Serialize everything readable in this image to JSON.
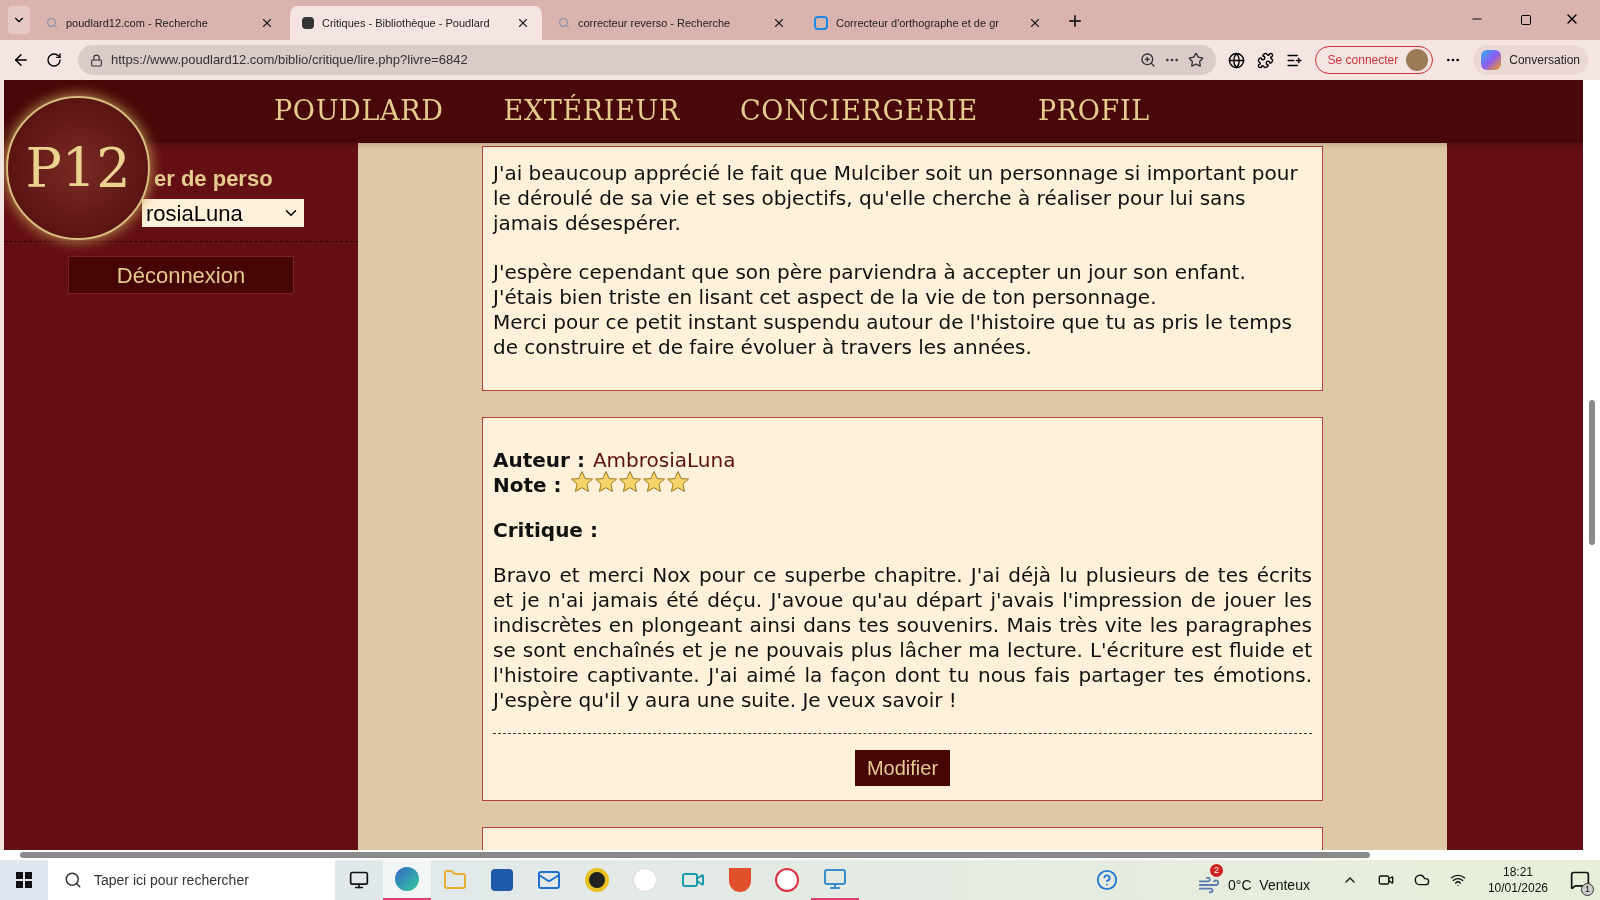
{
  "browser": {
    "tabs": [
      {
        "title": "poudlard12.com - Recherche",
        "kind": "search",
        "selected": false
      },
      {
        "title": "Critiques - Bibliothèque - Poudlard",
        "kind": "site",
        "selected": true
      },
      {
        "title": "correcteur reverso - Recherche",
        "kind": "search",
        "selected": false
      },
      {
        "title": "Correcteur d'orthographe et de gr",
        "kind": "app",
        "selected": false
      }
    ],
    "url": "https://www.poudlard12.com/biblio/critique/lire.php?livre=6842",
    "signin": "Se connecter",
    "copilot": "Conversation"
  },
  "nav": [
    "POUDLARD",
    "EXTÉRIEUR",
    "CONCIERGERIE",
    "PROFIL"
  ],
  "logo": "P12",
  "sidebar": {
    "heading": "er de perso",
    "character_select": "rosiaLuna",
    "logout": "Déconnexion"
  },
  "reviews": [
    {
      "paragraphs": [
        "J'ai beaucoup apprécié le fait que Mulciber soit un personnage si important pour le déroulé de sa vie et ses objectifs, qu'elle cherche à réaliser pour lui sans jamais désespérer.",
        "J'espère cependant que son père parviendra à accepter un jour son enfant.\nJ'étais bien triste en lisant cet aspect de la vie de ton personnage.\nMerci pour ce petit instant suspendu autour de l'histoire que tu as pris le temps de construire et de faire évoluer à travers les années."
      ]
    },
    {
      "author_label": "Auteur :",
      "author": "AmbrosiaLuna",
      "rating_label": "Note :",
      "stars": 5,
      "critique_label": "Critique :",
      "paragraphs": [
        "Bravo et merci Nox pour ce superbe chapitre. J'ai déjà lu plusieurs de tes écrits et je n'ai jamais été déçu. J'avoue qu'au départ j'avais l'impression de jouer les indiscrètes en plongeant ainsi dans tes souvenirs. Mais très vite les paragraphes se sont enchaînés et je ne pouvais plus lâcher ma lecture. L'écriture est fluide et l'histoire captivante. J'ai aimé la façon dont tu nous fais partager tes émotions. J'espère qu'il y aura une suite. Je veux savoir !"
      ],
      "button": "Modifier"
    }
  ],
  "taskbar": {
    "search_placeholder": "Taper ici pour rechercher",
    "weather_badge": "2",
    "weather": "0°C  Venteux",
    "time": "18:21",
    "date": "10/01/2026",
    "notifications": "1"
  }
}
